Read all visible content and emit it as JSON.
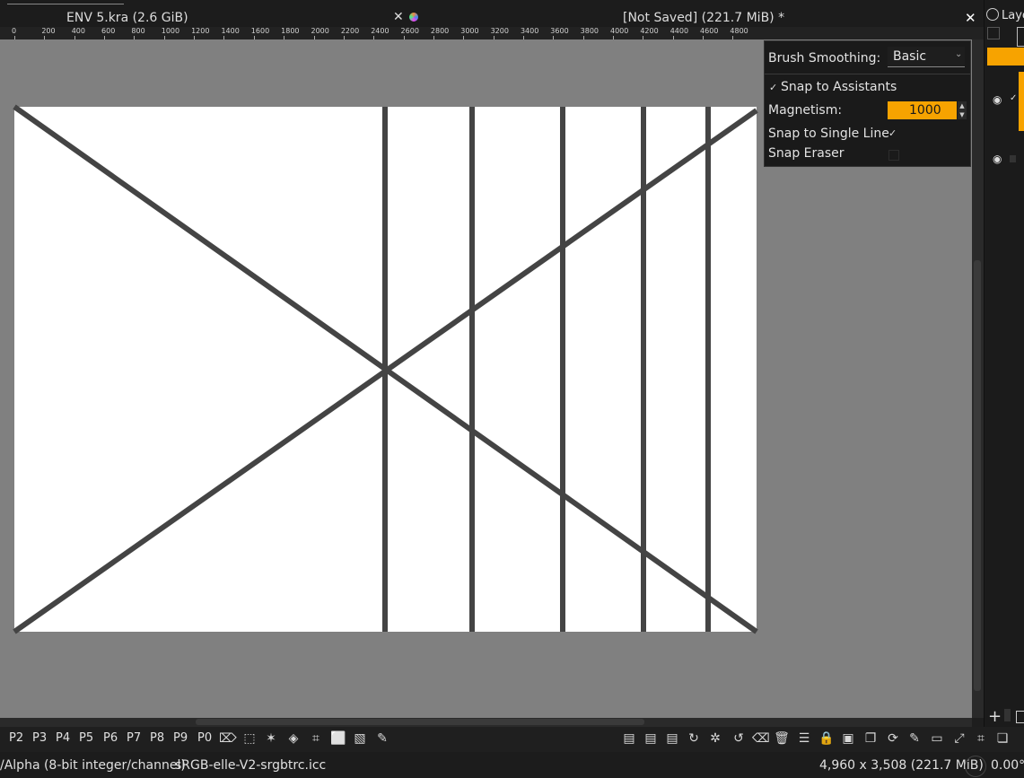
{
  "window": {
    "doc_tab": "ENV 5.kra (2.6 GiB)",
    "doc_title": "[Not Saved]  (221.7 MiB) *",
    "close_glyph": "✕",
    "layers_label": "Laye"
  },
  "ruler": {
    "ticks": [
      "0",
      "200",
      "400",
      "600",
      "800",
      "1000",
      "1200",
      "1400",
      "1600",
      "1800",
      "2000",
      "2200",
      "2400",
      "2600",
      "2800",
      "3000",
      "3200",
      "3400",
      "3600",
      "3800",
      "4000",
      "4200",
      "4400",
      "4600",
      "4800"
    ]
  },
  "tool_options": {
    "brush_smoothing_label": "Brush Smoothing:",
    "brush_smoothing_value": "Basic",
    "snap_to_assistants_label": "Snap to Assistants",
    "snap_to_assistants_checked": true,
    "magnetism_label": "Magnetism:",
    "magnetism_value": "1000",
    "snap_single_line_label": "Snap to Single Line",
    "snap_single_line_checked": true,
    "snap_eraser_label": "Snap Eraser",
    "snap_eraser_checked": false,
    "accent_color": "#f7a300"
  },
  "canvas": {
    "background": "#808080",
    "paper": "#ffffff",
    "line_color": "#444444"
  },
  "presets": [
    "P2",
    "P3",
    "P4",
    "P5",
    "P6",
    "P7",
    "P8",
    "P9",
    "P0"
  ],
  "toolbar_icons": [
    "eraser-icon",
    "transform-icon",
    "magic-wand-icon",
    "fill-icon",
    "crop-icon",
    "select-rect-icon",
    "gradient-icon",
    "brush-icon"
  ],
  "status": {
    "color_model": "/Alpha (8-bit integer/channel)",
    "profile": "sRGB-elle-V2-srgbtrc.icc",
    "dimensions": "4,960 x 3,508 (221.7 MiB)",
    "rotation": "0.00°"
  }
}
